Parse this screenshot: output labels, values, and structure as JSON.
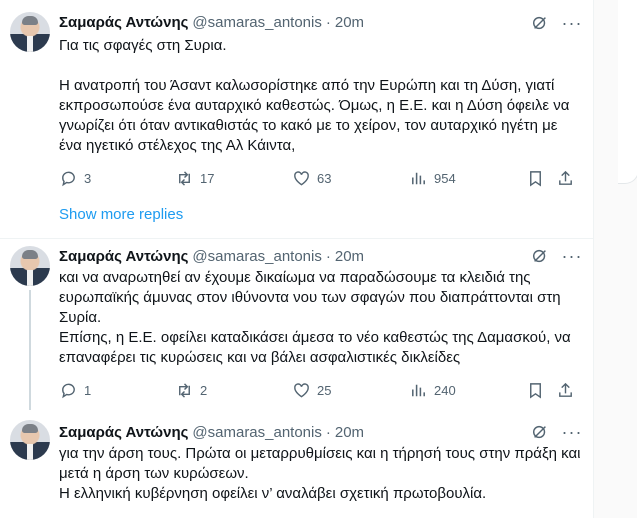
{
  "tweets": [
    {
      "name": "Σαμαράς Αντώνης",
      "handle": "@samaras_antonis",
      "dot": "·",
      "time": "20m",
      "text": "Για τις σφαγές στη Συρια.\n\nΗ ανατροπή του Άσαντ καλωσορίστηκε από την Ευρώπη και τη Δύση, γιατί εκπροσωπούσε ένα αυταρχικό καθεστώς. Όμως, η Ε.Ε. και η Δύση όφειλε να γνωρίζει ότι όταν αντικαθιστάς το κακό με το χείρον, τον αυταρχικό ηγέτη με ένα ηγετικό στέλεχος της Αλ Κάιντα,",
      "replies": "3",
      "reposts": "17",
      "likes": "63",
      "views": "954"
    },
    {
      "name": "Σαμαράς Αντώνης",
      "handle": "@samaras_antonis",
      "dot": "·",
      "time": "20m",
      "text": "και να αναρωτηθεί αν έχουμε δικαίωμα να παραδώσουμε τα κλειδιά της ευρωπαϊκής άμυνας στον ιθύνοντα νου των σφαγών που διαπράττονται στη Συρία.\nΕπίσης, η Ε.Ε. οφείλει καταδικάσει άμεσα το νέο καθεστώς της Δαμασκού, να επαναφέρει τις κυρώσεις και να βάλει ασφαλιστικές δικλείδες",
      "replies": "1",
      "reposts": "2",
      "likes": "25",
      "views": "240"
    },
    {
      "name": "Σαμαράς Αντώνης",
      "handle": "@samaras_antonis",
      "dot": "·",
      "time": "20m",
      "text": "για την άρση τους. Πρώτα οι μεταρρυθμίσεις και η τήρησή τους στην πράξη και μετά η άρση των κυρώσεων.\nΗ ελληνική κυβέρνηση οφείλει ν’ αναλάβει σχετική πρωτοβουλία."
    }
  ],
  "show_more_replies": "Show more replies",
  "colors": {
    "accent": "#1d9bf0",
    "muted": "#536471",
    "text": "#0f1419"
  },
  "icons": [
    "grok-icon",
    "more-icon",
    "reply-icon",
    "repost-icon",
    "like-icon",
    "views-icon",
    "bookmark-icon",
    "share-icon"
  ]
}
